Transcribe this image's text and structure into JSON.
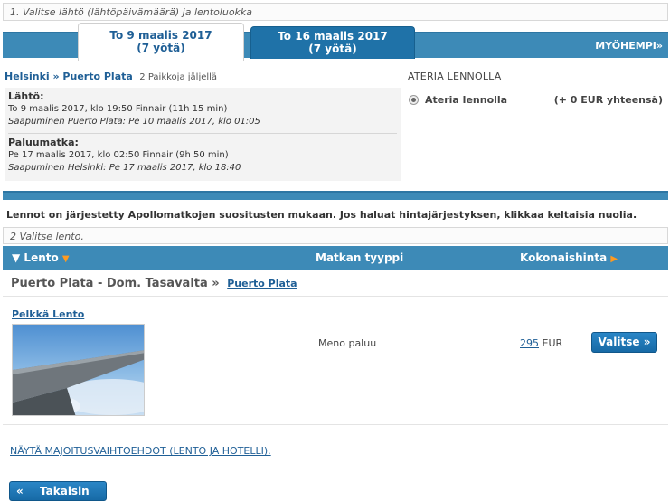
{
  "step1": {
    "label": "1. Valitse lähtö (lähtöpäivämäärä) ja lentoluokka"
  },
  "date_tabs": [
    {
      "line1": "To 9 maalis 2017",
      "line2": "(7 yötä)"
    },
    {
      "line1": "To 16 maalis 2017",
      "line2": "(7 yötä)"
    }
  ],
  "later": {
    "label": "MYÖHEMPI",
    "icon": "»"
  },
  "route": {
    "link": "Helsinki » Puerto Plata",
    "seats": "2 Paikkoja jäljellä"
  },
  "outbound": {
    "heading": "Lähtö:",
    "detail": "To 9 maalis 2017, klo 19:50 Finnair (11h 15 min)",
    "arrival": "Saapuminen Puerto Plata: Pe 10 maalis 2017, klo 01:05"
  },
  "inbound": {
    "heading": "Paluumatka:",
    "detail": "Pe 17 maalis 2017, klo 02:50 Finnair (9h 50 min)",
    "arrival": "Saapuminen Helsinki: Pe 17 maalis 2017, klo 18:40"
  },
  "meal": {
    "title": "ATERIA LENNOLLA",
    "option": "Ateria lennolla",
    "price": "(+ 0 EUR yhteensä)"
  },
  "sort_note": "Lennot on järjestetty Apollomatkojen suositusten mukaan. Jos haluat hintajärjestyksen, klikkaa keltaisia nuolia.",
  "step2": {
    "label": "2 Valitse lento."
  },
  "list_header": {
    "flight": "Lento",
    "type": "Matkan tyyppi",
    "total": "Kokonaishinta"
  },
  "destination": {
    "title": "Puerto Plata - Dom. Tasavalta »",
    "link": "Puerto Plata"
  },
  "product": {
    "name": "Pelkkä Lento",
    "trip_type": "Meno paluu",
    "price": "295",
    "currency": "EUR",
    "select_label": "Valitse »"
  },
  "hotel_link": "NÄYTÄ MAJOITUSVAIHTOEHDOT (LENTO JA HOTELLI).",
  "back": {
    "icon": "«",
    "label": "Takaisin"
  }
}
